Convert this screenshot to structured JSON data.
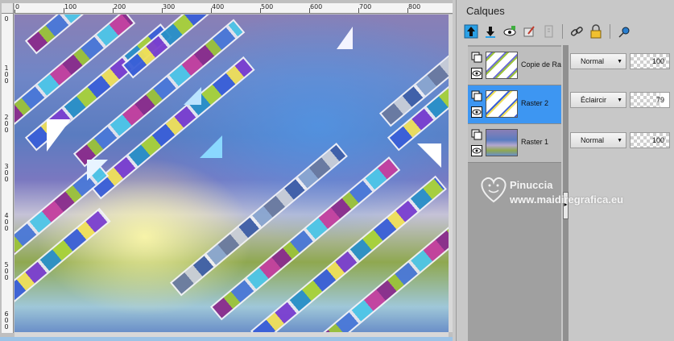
{
  "ruler_top": {
    "labels": [
      "0",
      "100",
      "200",
      "300",
      "400",
      "500",
      "600",
      "700",
      "800"
    ]
  },
  "ruler_left": {
    "labels": [
      "0",
      "1\n0\n0",
      "2\n0\n0",
      "3\n0\n0",
      "4\n0\n0",
      "5\n0\n0",
      "6\n0\n0"
    ]
  },
  "panel": {
    "title": "Calques",
    "toolbar_icons": [
      "move-up-icon",
      "move-down-icon",
      "eye-view-icon",
      "paint-brush-icon",
      "ghost-layer-icon",
      "link-icon",
      "lock-icon",
      "pin-icon"
    ]
  },
  "layers": [
    {
      "name": "Copie de Ras",
      "blend": "Normal",
      "opacity": 100,
      "selected": false
    },
    {
      "name": "Raster 2",
      "blend": "Éclaircir",
      "opacity": 79,
      "selected": true
    },
    {
      "name": "Raster 1",
      "blend": "Normal",
      "opacity": 100,
      "selected": false
    }
  ],
  "watermark": {
    "name": "Pinuccia",
    "url": "www.maidiregrafica.eu"
  },
  "colors": {
    "selected_layer": "#3d96f2",
    "panel_bg": "#c8c8c8"
  }
}
